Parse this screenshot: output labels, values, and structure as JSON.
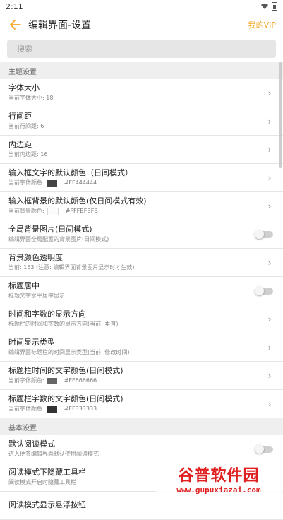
{
  "status_bar": {
    "time": "2:11"
  },
  "header": {
    "title": "编辑界面-设置",
    "vip_label": "我的VIP"
  },
  "search": {
    "placeholder": "搜索"
  },
  "sections": {
    "theme": {
      "label": "主题设置"
    },
    "basic": {
      "label": "基本设置"
    }
  },
  "theme_items": [
    {
      "title": "字体大小",
      "subtitle": "当前字体大小: 18"
    },
    {
      "title": "行间距",
      "subtitle": "当前行间距: 6"
    },
    {
      "title": "内边距",
      "subtitle": "当前内边距: 16"
    },
    {
      "title": "输入框文字的默认颜色（日间模式）",
      "subtitle": "当前字体颜色:",
      "color_hex": "#FF444444",
      "swatch": "#444444"
    },
    {
      "title": "输入框背景的默认颜色(仅日间模式有效)",
      "subtitle": "当前背景颜色:",
      "color_hex": "#FFFBFBFB",
      "swatch": "#FBFBFB"
    },
    {
      "title": "全局背景图片(日间模式)",
      "subtitle": "编辑界面全局配置的背景图片(日间模式)",
      "toggle": false
    },
    {
      "title": "背景颜色透明度",
      "subtitle": "当前: 153 (注意: 编辑界面背景图片显示时才生效)"
    },
    {
      "title": "标题居中",
      "subtitle": "标题文字水平居中显示",
      "toggle": false
    },
    {
      "title": "时间和字数的显示方向",
      "subtitle": "标题栏的时间和字数的显示方向(当前: 垂直)"
    },
    {
      "title": "时间显示类型",
      "subtitle": "编辑界面标题栏的时间显示类型(当前: 修改时间)"
    },
    {
      "title": "标题栏时间的文字颜色(日间模式)",
      "subtitle": "当前字体颜色:",
      "color_hex": "#FF666666",
      "swatch": "#666666"
    },
    {
      "title": "标题栏字数的文字颜色(日间模式)",
      "subtitle": "当前字体颜色:",
      "color_hex": "#FF333333",
      "swatch": "#333333"
    }
  ],
  "basic_items": [
    {
      "title": "默认阅读模式",
      "subtitle": "进入便签编辑界面默认使用阅读模式",
      "toggle": false
    },
    {
      "title": "阅读模式下隐藏工具栏",
      "subtitle": "阅读模式开启时隐藏工具栏"
    },
    {
      "title": "阅读模式显示悬浮按钮",
      "subtitle": ""
    }
  ],
  "watermark": {
    "logo": "谷普软件园",
    "url": "www.gupuxiazai.com"
  },
  "colors": {
    "accent": "#f5a623",
    "watermark": "#e02020"
  }
}
